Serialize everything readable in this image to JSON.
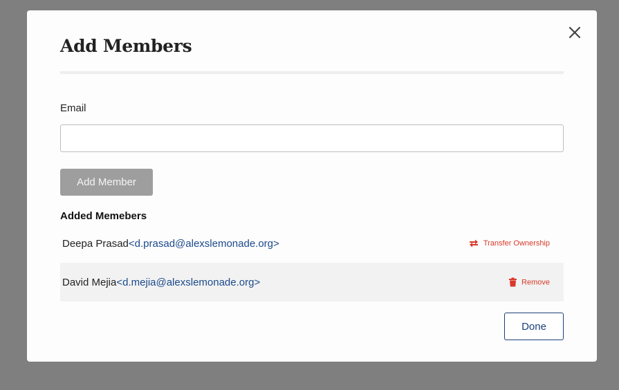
{
  "modal": {
    "title": "Add Members",
    "email_label": "Email",
    "email_value": "",
    "email_placeholder": "",
    "add_button_label": "Add Member",
    "section_title": "Added Memebers",
    "done_button_label": "Done"
  },
  "members": [
    {
      "name": "Deepa Prasad",
      "email": "<d.prasad@alexslemonade.org>",
      "action_label": "Transfer Ownership",
      "action_icon": "transfer-icon"
    },
    {
      "name": "David Mejia",
      "email": "<d.mejia@alexslemonade.org>",
      "action_label": "Remove",
      "action_icon": "trash-icon"
    }
  ],
  "colors": {
    "overlay": "#7f7f7f",
    "link": "#1b4a8c",
    "danger": "#d83a2a",
    "primary_outline": "#1b3f7a",
    "disabled_button": "#9e9e9e"
  }
}
